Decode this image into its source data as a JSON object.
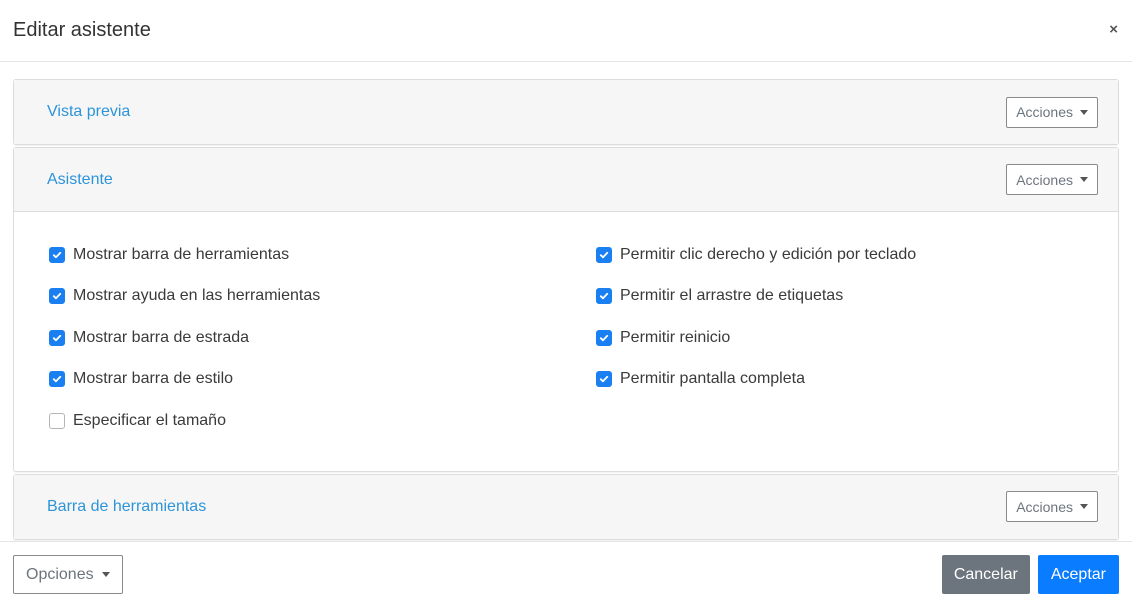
{
  "dialog": {
    "title": "Editar asistente",
    "close_symbol": "×"
  },
  "panels": [
    {
      "title": "Vista previa",
      "actions_label": "Acciones"
    },
    {
      "title": "Asistente",
      "actions_label": "Acciones"
    },
    {
      "title": "Barra de herramientas",
      "actions_label": "Acciones"
    }
  ],
  "options_left": [
    {
      "label": "Mostrar barra de herramientas",
      "checked": true
    },
    {
      "label": "Mostrar ayuda en las herramientas",
      "checked": true
    },
    {
      "label": "Mostrar barra de estrada",
      "checked": true
    },
    {
      "label": "Mostrar barra de estilo",
      "checked": true
    },
    {
      "label": "Especificar el tamaño",
      "checked": false
    }
  ],
  "options_right": [
    {
      "label": "Permitir clic derecho y edición por teclado",
      "checked": true
    },
    {
      "label": "Permitir el arrastre de etiquetas",
      "checked": true
    },
    {
      "label": "Permitir reinicio",
      "checked": true
    },
    {
      "label": "Permitir pantalla completa",
      "checked": true
    }
  ],
  "footer": {
    "options_label": "Opciones",
    "cancel_label": "Cancelar",
    "accept_label": "Aceptar"
  },
  "colors": {
    "accent": "#2e94d8",
    "checkbox": "#1a7ff0",
    "primary_button": "#0a7cff",
    "secondary_button": "#6c757d"
  }
}
